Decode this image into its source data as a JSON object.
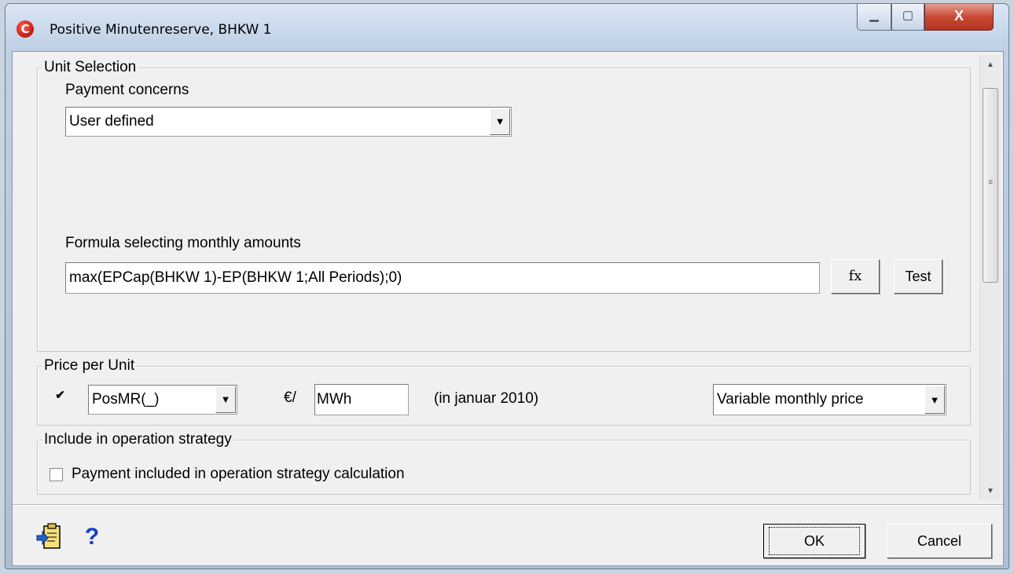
{
  "window": {
    "title": "Positive Minutenreserve, BHKW 1",
    "app_icon_glyph": "C",
    "controls": {
      "minimize": "▁",
      "maximize": "▢",
      "close": "X"
    }
  },
  "unit_selection": {
    "legend": "Unit Selection",
    "payment_concerns_label": "Payment concerns",
    "payment_concerns_value": "User defined",
    "formula_label": "Formula selecting monthly amounts",
    "formula_value": "max(EPCap(BHKW 1)-EP(BHKW 1;All Periods);0)",
    "fx_button": "fx",
    "test_button": "Test"
  },
  "price_per_unit": {
    "legend": "Price per Unit",
    "checked": true,
    "price_series": "PosMR(_)",
    "currency_prefix": "€/",
    "unit_value": "MWh",
    "period_note": "(in  januar 2010)",
    "price_mode": "Variable monthly price"
  },
  "operation_strategy": {
    "legend": "Include in operation strategy",
    "checkbox_label": "Payment included in operation strategy calculation",
    "checked": false
  },
  "footer": {
    "ok_label": "OK",
    "cancel_label": "Cancel",
    "help_glyph": "?"
  },
  "icons": [
    "app-logo-icon",
    "paste-report-icon",
    "help-icon",
    "dropdown-arrow-icon",
    "scroll-up-icon",
    "scroll-down-icon"
  ]
}
